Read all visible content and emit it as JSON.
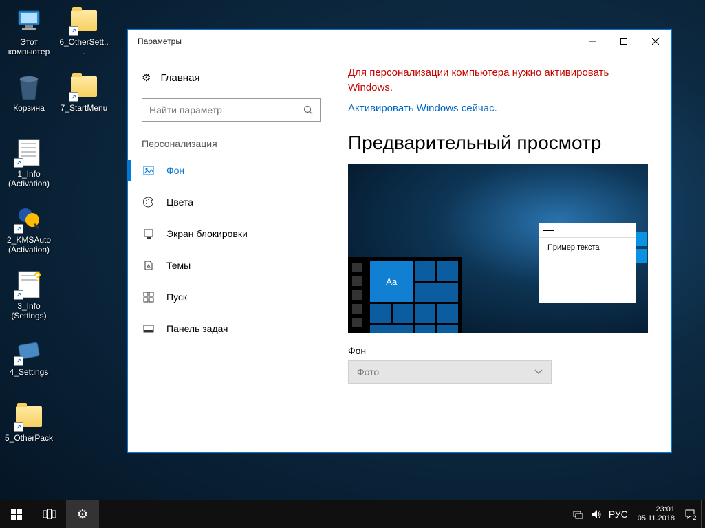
{
  "desktop": {
    "icons": [
      {
        "label": "Этот компьютер",
        "type": "computer"
      },
      {
        "label": "6_OtherSett...",
        "type": "folder"
      },
      {
        "label": "Корзина",
        "type": "recycle"
      },
      {
        "label": "7_StartMenu",
        "type": "folder"
      },
      {
        "label": "1_Info (Activation)",
        "type": "text-shortcut"
      },
      {
        "label": "2_KMSAuto (Activation)",
        "type": "app-shortcut"
      },
      {
        "label": "3_Info (Settings)",
        "type": "text-shortcut"
      },
      {
        "label": "4_Settings",
        "type": "app-shortcut"
      },
      {
        "label": "5_OtherPack",
        "type": "folder"
      }
    ]
  },
  "settings": {
    "title": "Параметры",
    "home": "Главная",
    "search_placeholder": "Найти параметр",
    "section": "Персонализация",
    "nav": [
      {
        "icon": "picture-icon",
        "label": "Фон",
        "active": true
      },
      {
        "icon": "palette-icon",
        "label": "Цвета",
        "active": false
      },
      {
        "icon": "lockscreen-icon",
        "label": "Экран блокировки",
        "active": false
      },
      {
        "icon": "themes-icon",
        "label": "Темы",
        "active": false
      },
      {
        "icon": "start-icon",
        "label": "Пуск",
        "active": false
      },
      {
        "icon": "taskbar-icon",
        "label": "Панель задач",
        "active": false
      }
    ],
    "warning": "Для персонализации компьютера нужно активировать Windows.",
    "activate_link": "Активировать Windows сейчас.",
    "preview_heading": "Предварительный просмотр",
    "preview_sample_text": "Пример текста",
    "preview_tile_text": "Aa",
    "background_label": "Фон",
    "background_value": "Фото"
  },
  "taskbar": {
    "lang": "РУС",
    "time": "23:01",
    "date": "05.11.2018",
    "notification_count": "2"
  }
}
